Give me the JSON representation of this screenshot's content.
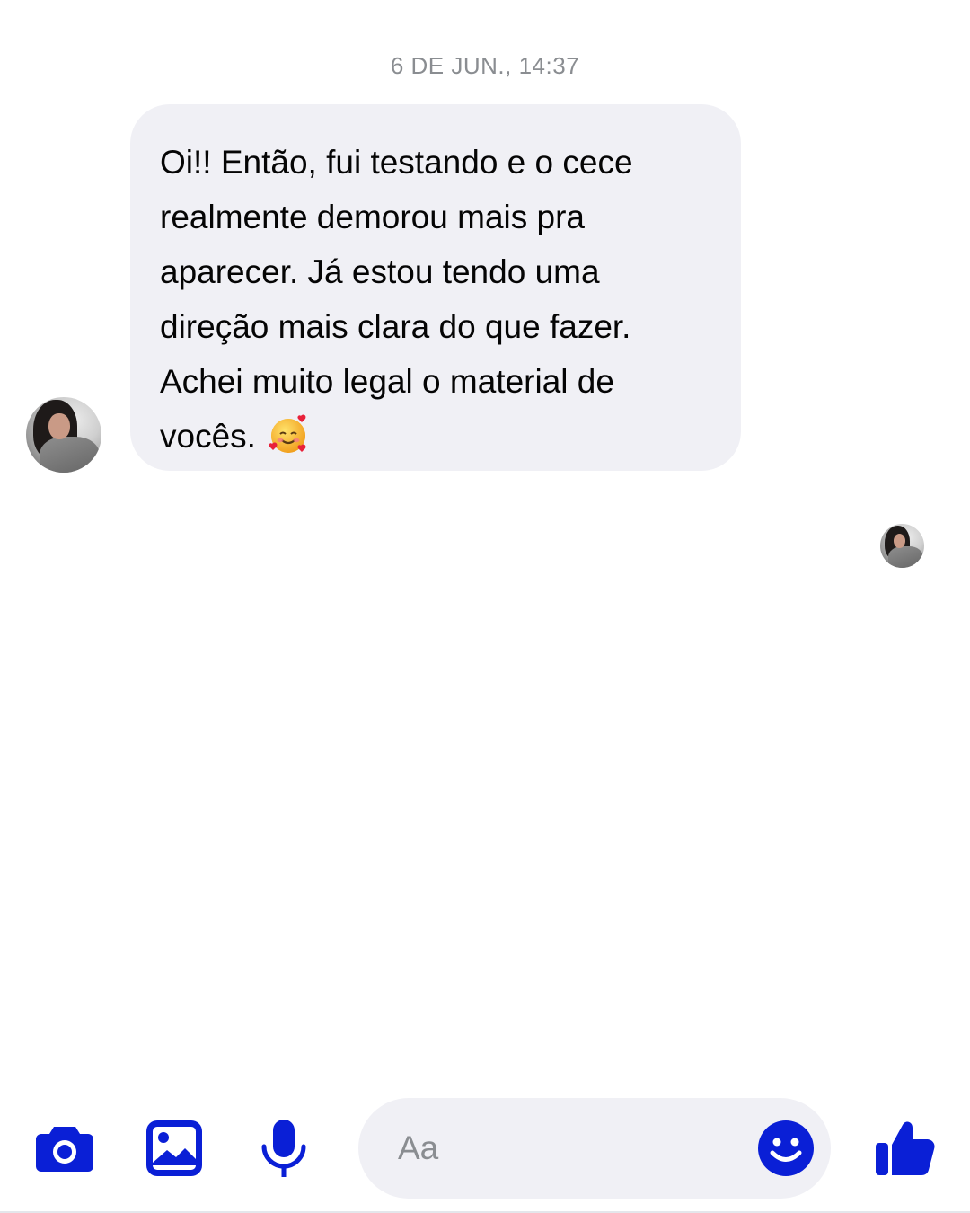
{
  "conversation": {
    "timestamp": "6 DE JUN., 14:37",
    "message": {
      "text": "Oi!! Então, fui testando e o cece\nrealmente demorou mais pra\naparecer. Já estou tendo uma\ndireção mais clara do que fazer.\nAchei muito legal o material de\nvocês.",
      "emoji": "smiling-face-with-hearts"
    }
  },
  "composer": {
    "placeholder": "Aa"
  },
  "icons": {
    "camera": "camera-icon",
    "gallery": "image-icon",
    "microphone": "microphone-icon",
    "emoji": "smiley-icon",
    "like": "thumbs-up-icon"
  },
  "colors": {
    "accent": "#0a1fd6",
    "bubble": "#f0f0f5",
    "timestamp": "#8a8d91"
  }
}
